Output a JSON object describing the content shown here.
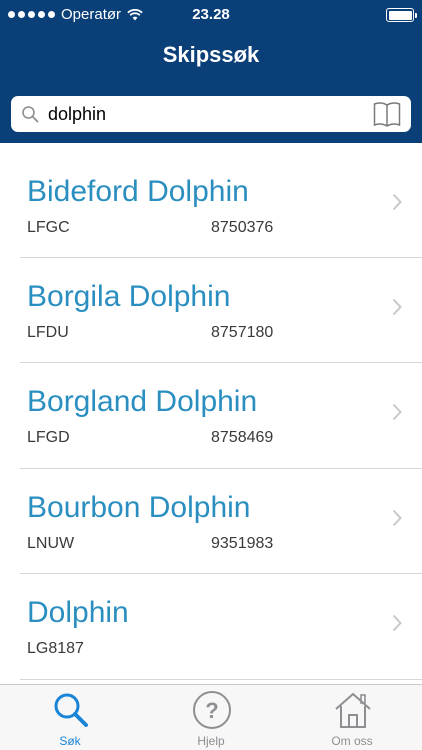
{
  "status_bar": {
    "carrier": "Operatør",
    "time": "23.28"
  },
  "nav": {
    "title": "Skipssøk"
  },
  "search": {
    "value": "dolphin",
    "placeholder": ""
  },
  "results": [
    {
      "name": "Bideford Dolphin",
      "callsign": "LFGC",
      "imo": "8750376"
    },
    {
      "name": "Borgila Dolphin",
      "callsign": "LFDU",
      "imo": "8757180"
    },
    {
      "name": "Borgland Dolphin",
      "callsign": "LFGD",
      "imo": "8758469"
    },
    {
      "name": "Bourbon Dolphin",
      "callsign": "LNUW",
      "imo": "9351983"
    },
    {
      "name": "Dolphin",
      "callsign": "LG8187",
      "imo": ""
    }
  ],
  "tabs": [
    {
      "label": "Søk",
      "icon": "search-icon",
      "active": true
    },
    {
      "label": "Hjelp",
      "icon": "help-icon",
      "active": false
    },
    {
      "label": "Om oss",
      "icon": "home-icon",
      "active": false
    }
  ],
  "colors": {
    "nav_background": "#0a3f78",
    "ship_name": "#2a8fc0",
    "active_tab": "#1a84d6",
    "inactive_tab": "#8e8e93"
  }
}
